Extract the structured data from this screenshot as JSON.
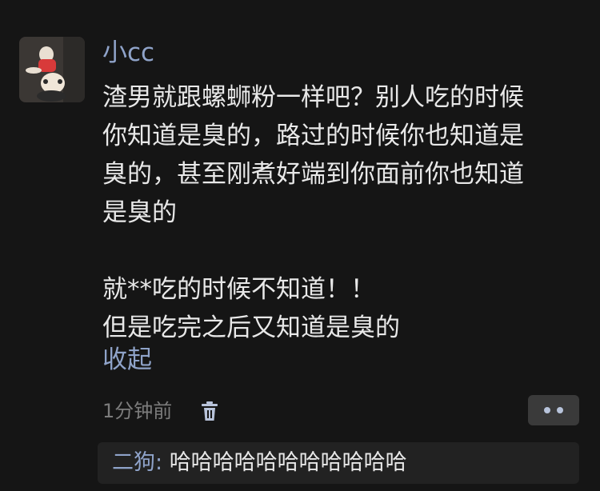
{
  "comment": {
    "username": "小cc",
    "lines": [
      "渣男就跟螺蛳粉一样吧？别人吃的时候",
      "你知道是臭的，路过的时候你也知道是",
      "臭的，甚至刚煮好端到你面前你也知道",
      "是臭的",
      "就**吃的时候不知道！！",
      "但是吃完之后又知道是臭的"
    ],
    "collapse_label": "收起",
    "timestamp": "1分钟前"
  },
  "icons": {
    "delete": "trash-icon",
    "more": "more-dots-icon"
  },
  "reply": {
    "author": "二狗",
    "separator": ": ",
    "text": "哈哈哈哈哈哈哈哈哈哈哈"
  },
  "colors": {
    "background": "#151515",
    "link": "#8fa3c9",
    "text": "#e8e8e8",
    "muted": "#7c7c7c"
  }
}
